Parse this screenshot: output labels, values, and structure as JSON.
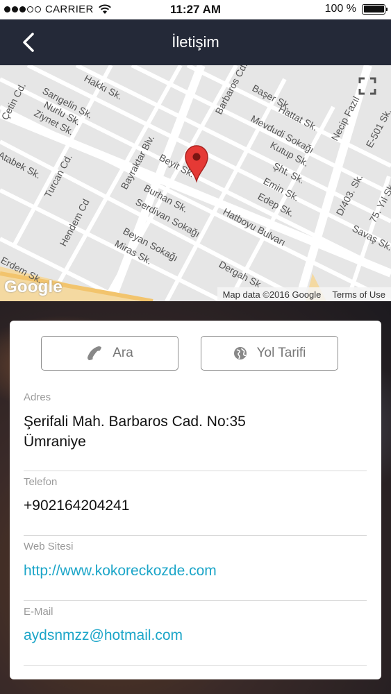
{
  "status_bar": {
    "carrier": "CARRIER",
    "time": "11:27 AM",
    "battery": "100 %"
  },
  "nav": {
    "title": "İletişim"
  },
  "map": {
    "streets": [
      "Sarıgelin Sk.",
      "Nurlu Sk.",
      "Ziynet Sk.",
      "Çetin Cd.",
      "Hakkı Sk.",
      "Barbaros Cd.",
      "Başer Sk.",
      "Mevdudi Sokağı",
      "Hattat Sk.",
      "Kutup Sk.",
      "Şht. Sk.",
      "Emin Sk.",
      "Edep Sk.",
      "Necip Fazıl",
      "E-501 Sk.",
      "Bayraktar Blv.",
      "Beyit Sk.",
      "Burhan Sk.",
      "Serdivan Sokağı",
      "Hatboyu Bulvarı",
      "Beyan Sokağı",
      "Miras Sk.",
      "Dergah Sk",
      "Turcan Cd.",
      "Hendem Cd",
      "Atabek Sk.",
      "D/403. Sk.",
      "75. Yıl Sk.",
      "Savaş Sk.",
      "Erdem Sk."
    ],
    "google_logo": "Google",
    "attribution": "Map data ©2016 Google",
    "terms": "Terms of Use"
  },
  "actions": {
    "call_label": "Ara",
    "directions_label": "Yol Tarifi"
  },
  "contact": {
    "address_label": "Adres",
    "address_line1": "Şerifali Mah. Barbaros Cad. No:35",
    "address_line2": "Ümraniye",
    "phone_label": "Telefon",
    "phone": "+902164204241",
    "website_label": "Web Sitesi",
    "website": "http://www.kokoreckozde.com",
    "email_label": "E-Mail",
    "email": "aydsnmzz@hotmail.com"
  },
  "colors": {
    "nav_bg": "#242938",
    "link": "#1ba5c8",
    "pin": "#e53935"
  },
  "icons": {
    "back": "chevron-left-icon",
    "fullscreen": "fullscreen-icon",
    "pin": "map-pin-icon",
    "call": "phone-icon",
    "directions": "globe-icon"
  }
}
